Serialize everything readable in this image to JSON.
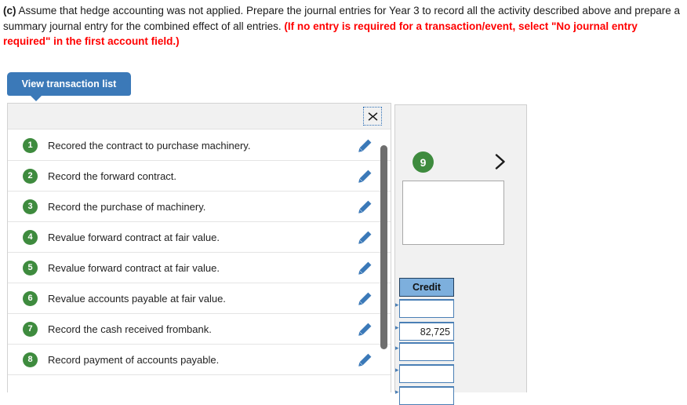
{
  "question": {
    "label": "(c)",
    "body": " Assume that hedge accounting was not applied. Prepare the journal entries for Year 3 to record all the activity described above and prepare a summary journal entry for the combined effect of all entries. ",
    "instruction": "(If no entry is required for a transaction/event, select \"No journal entry required\" in the first account field.)",
    "accent_red": "#ff0000"
  },
  "tab": {
    "label": "View transaction list",
    "color": "#3b79b8"
  },
  "transaction_panel": {
    "close_icon": "close-x-icon",
    "badge_color": "#3e8b3e",
    "edit_icon": "pencil-icon",
    "items": [
      {
        "num": "1",
        "text": "Recored the contract to purchase machinery."
      },
      {
        "num": "2",
        "text": "Record the forward contract."
      },
      {
        "num": "3",
        "text": "Record the purchase of machinery."
      },
      {
        "num": "4",
        "text": "Revalue forward contract at fair value."
      },
      {
        "num": "5",
        "text": "Revalue forward contract at fair value."
      },
      {
        "num": "6",
        "text": "Revalue accounts payable at fair value."
      },
      {
        "num": "7",
        "text": "Record the cash received frombank."
      },
      {
        "num": "8",
        "text": "Record payment of accounts payable."
      }
    ]
  },
  "journal_panel": {
    "step_badge": "9",
    "next_icon": "chevron-right-icon",
    "entry_textbox_value": "",
    "credit_header": "Credit",
    "header_color": "#7dafdd",
    "credit_rows": [
      {
        "value": ""
      },
      {
        "value": "82,725"
      },
      {
        "value": ""
      },
      {
        "value": ""
      },
      {
        "value": ""
      }
    ]
  }
}
